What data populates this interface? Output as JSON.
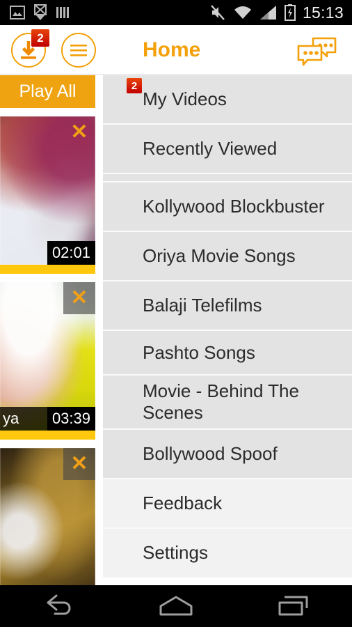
{
  "statusbar": {
    "icons": [
      "image-icon",
      "download-cancel-icon",
      "bars-icon",
      "mute-icon",
      "wifi-icon",
      "signal-icon",
      "battery-charging-icon"
    ],
    "time": "15:13"
  },
  "actionbar": {
    "download_icon": "download-circle-icon",
    "download_badge": "2",
    "menu_icon": "hamburger-circle-icon",
    "title": "Home",
    "chat_icon": "chat-bubbles-icon"
  },
  "leftpanel": {
    "play_all_label": "Play All",
    "close_icon": "close-x-icon",
    "videos": [
      {
        "title": "",
        "duration": "02:01",
        "boxed_close": false
      },
      {
        "title": "ya",
        "duration": "03:39",
        "boxed_close": true
      },
      {
        "title": "",
        "duration": "",
        "boxed_close": true
      }
    ]
  },
  "menu": {
    "items": [
      {
        "label": "My Videos",
        "badge": "2",
        "light": false,
        "two_line": false
      },
      {
        "label": "Recently Viewed",
        "badge": "",
        "light": false,
        "two_line": false
      },
      {
        "label": "Kollywood Blockbuster",
        "badge": "",
        "light": false,
        "two_line": false
      },
      {
        "label": "Oriya Movie Songs",
        "badge": "",
        "light": false,
        "two_line": false
      },
      {
        "label": "Balaji Telefilms",
        "badge": "",
        "light": false,
        "two_line": false
      },
      {
        "label": "Pashto Songs",
        "badge": "",
        "light": false,
        "two_line": false
      },
      {
        "label": "Movie - Behind The Scenes",
        "badge": "",
        "light": false,
        "two_line": true
      },
      {
        "label": "Bollywood Spoof",
        "badge": "",
        "light": false,
        "two_line": false
      },
      {
        "label": "Feedback",
        "badge": "",
        "light": true,
        "two_line": false
      },
      {
        "label": "Settings",
        "badge": "",
        "light": true,
        "two_line": false
      }
    ]
  },
  "navbar": {
    "back_icon": "back-arrow-icon",
    "home_icon": "home-icon",
    "recents_icon": "recents-icon"
  },
  "colors": {
    "accent_orange": "#f3a009",
    "play_all_orange": "#efa310",
    "badge_red": "#c20000",
    "bar_yellow": "#ffc80d",
    "menu_bg": "#e3e3e3",
    "menu_bg_light": "#f2f2f2"
  }
}
